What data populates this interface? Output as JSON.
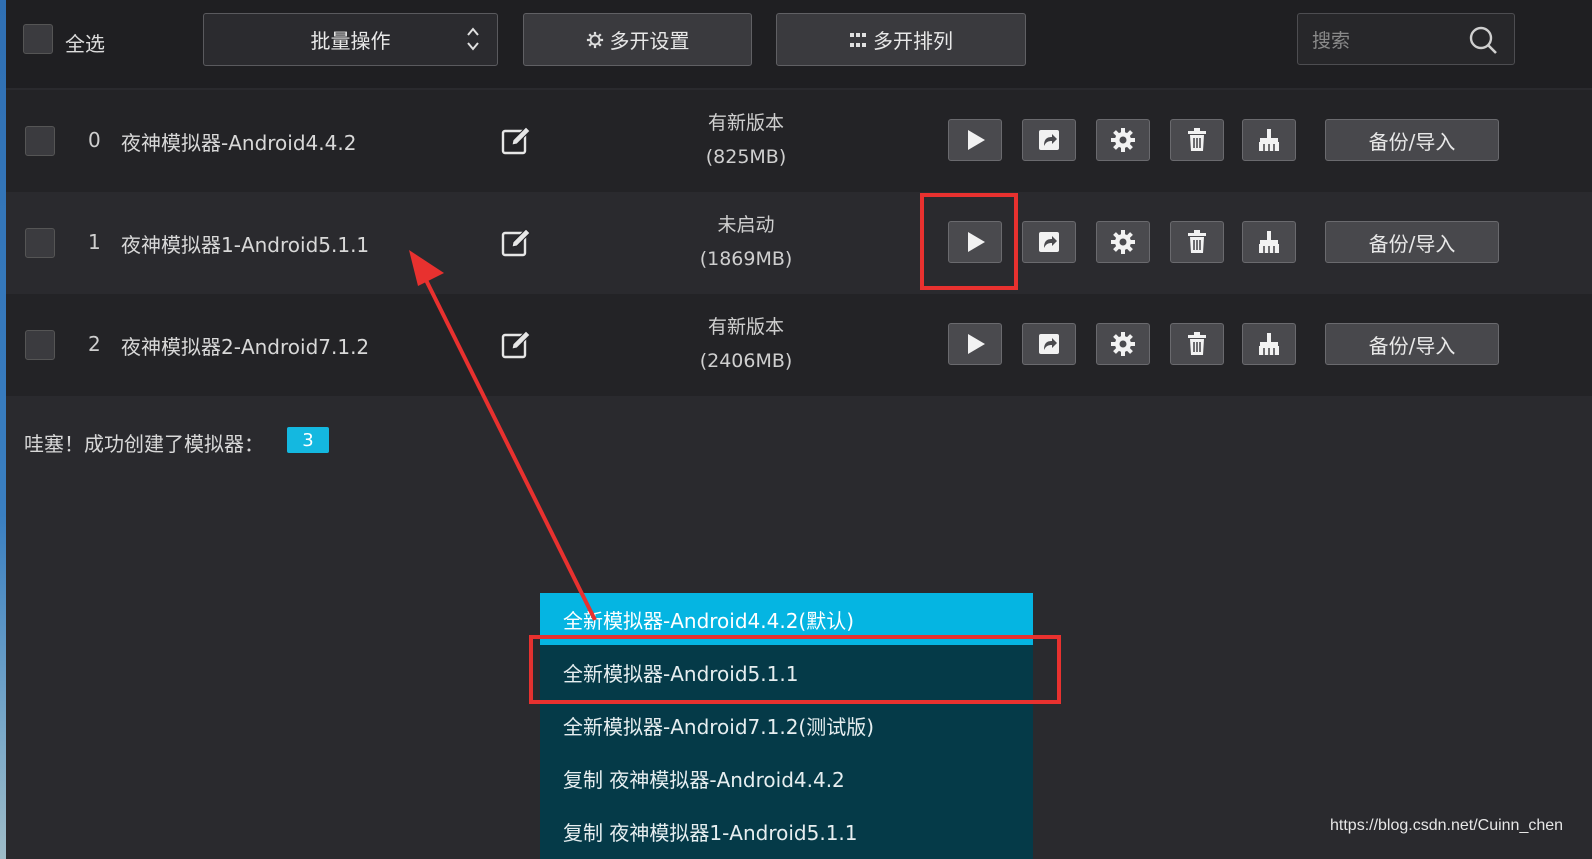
{
  "toolbar": {
    "select_all_label": "全选",
    "batch_label": "批量操作",
    "multi_settings_label": "多开设置",
    "multi_arrange_label": "多开排列",
    "search_placeholder": "搜索"
  },
  "rows": [
    {
      "index": "0",
      "name": "夜神模拟器-Android4.4.2",
      "status": "有新版本",
      "size": "(825MB)"
    },
    {
      "index": "1",
      "name": "夜神模拟器1-Android5.1.1",
      "status": "未启动",
      "size": "(1869MB)"
    },
    {
      "index": "2",
      "name": "夜神模拟器2-Android7.1.2",
      "status": "有新版本",
      "size": "(2406MB)"
    }
  ],
  "row_actions": {
    "icons": [
      "play-icon",
      "shortcut-icon",
      "gear-icon",
      "trash-icon",
      "broom-icon"
    ],
    "backup_label": "备份/导入"
  },
  "summary": {
    "text": "哇塞！成功创建了模拟器：",
    "count": "3"
  },
  "menu": {
    "items": [
      "全新模拟器-Android4.4.2(默认)",
      "全新模拟器-Android5.1.1",
      "全新模拟器-Android7.1.2(测试版)",
      "复制 夜神模拟器-Android4.4.2",
      "复制 夜神模拟器1-Android5.1.1"
    ],
    "active_index": 0
  },
  "watermark": "https://blog.csdn.net/Cuinn_chen",
  "colors": {
    "accent": "#05b5e2",
    "annotation_red": "#e8312f",
    "menu_bg": "#053a48"
  }
}
